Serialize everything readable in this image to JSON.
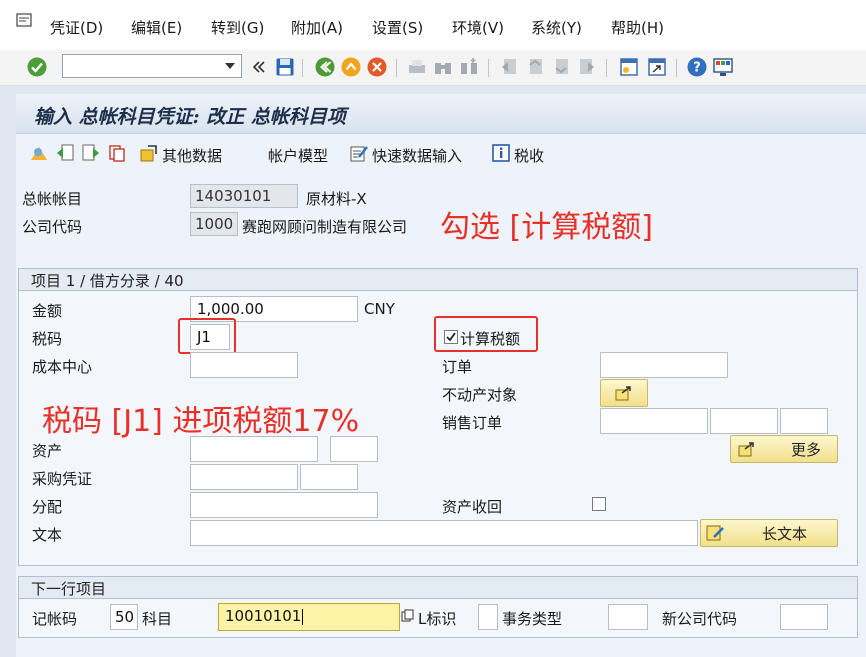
{
  "menu": {
    "items": [
      "凭证(D)",
      "编辑(E)",
      "转到(G)",
      "附加(A)",
      "设置(S)",
      "环境(V)",
      "系统(Y)",
      "帮助(H)"
    ]
  },
  "toolbar": {
    "command_field_value": ""
  },
  "title": "输入 总帐科目凭证: 改正 总帐科目项",
  "app_toolbar": {
    "other_data": "其他数据",
    "account_model": "帐户模型",
    "fast_entry": "快速数据输入",
    "tax": "税收"
  },
  "header": {
    "gl_account_label": "总帐帐目",
    "gl_account_value": "14030101",
    "gl_account_desc": "原材料-X",
    "company_code_label": "公司代码",
    "company_code_value": "1000",
    "company_code_desc": "赛跑网顾问制造有限公司"
  },
  "item_group": {
    "title": "项目 1 / 借方分录 / 40",
    "amount_label": "金额",
    "amount_value": "1,000.00",
    "currency": "CNY",
    "tax_code_label": "税码",
    "tax_code_value": "J1",
    "calc_tax_label": "计算税额",
    "calc_tax_checked": true,
    "cost_center_label": "成本中心",
    "order_label": "订单",
    "real_estate_label": "不动产对象",
    "sales_order_label": "销售订单",
    "more_button": "更多",
    "asset_label": "资产",
    "purchasing_doc_label": "采购凭证",
    "assignment_label": "分配",
    "asset_retirement_label": "资产收回",
    "text_label": "文本",
    "long_text_button": "长文本"
  },
  "next_item": {
    "title": "下一行项目",
    "posting_key_label": "记帐码",
    "posting_key_value": "50",
    "account_label": "科目",
    "account_value": "10010101",
    "sgl_label": "L标识",
    "transaction_type_label": "事务类型",
    "new_company_label": "新公司代码"
  },
  "annotations": {
    "check_calc_tax": "勾选 [计算税额]",
    "tax_code_note": "税码 [J1]  进项税额17%"
  },
  "colors": {
    "annotation": "#e8302a",
    "title_text": "#1d2f4a",
    "highlight_field": "#fff3a8"
  }
}
